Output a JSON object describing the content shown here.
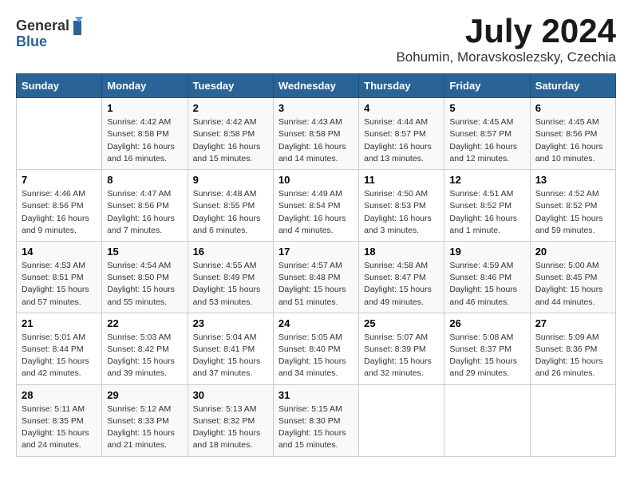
{
  "header": {
    "logo_general": "General",
    "logo_blue": "Blue",
    "month_year": "July 2024",
    "location": "Bohumin, Moravskoslezsky, Czechia"
  },
  "weekdays": [
    "Sunday",
    "Monday",
    "Tuesday",
    "Wednesday",
    "Thursday",
    "Friday",
    "Saturday"
  ],
  "weeks": [
    [
      {
        "day": "",
        "sunrise": "",
        "sunset": "",
        "daylight": ""
      },
      {
        "day": "1",
        "sunrise": "Sunrise: 4:42 AM",
        "sunset": "Sunset: 8:58 PM",
        "daylight": "Daylight: 16 hours and 16 minutes."
      },
      {
        "day": "2",
        "sunrise": "Sunrise: 4:42 AM",
        "sunset": "Sunset: 8:58 PM",
        "daylight": "Daylight: 16 hours and 15 minutes."
      },
      {
        "day": "3",
        "sunrise": "Sunrise: 4:43 AM",
        "sunset": "Sunset: 8:58 PM",
        "daylight": "Daylight: 16 hours and 14 minutes."
      },
      {
        "day": "4",
        "sunrise": "Sunrise: 4:44 AM",
        "sunset": "Sunset: 8:57 PM",
        "daylight": "Daylight: 16 hours and 13 minutes."
      },
      {
        "day": "5",
        "sunrise": "Sunrise: 4:45 AM",
        "sunset": "Sunset: 8:57 PM",
        "daylight": "Daylight: 16 hours and 12 minutes."
      },
      {
        "day": "6",
        "sunrise": "Sunrise: 4:45 AM",
        "sunset": "Sunset: 8:56 PM",
        "daylight": "Daylight: 16 hours and 10 minutes."
      }
    ],
    [
      {
        "day": "7",
        "sunrise": "Sunrise: 4:46 AM",
        "sunset": "Sunset: 8:56 PM",
        "daylight": "Daylight: 16 hours and 9 minutes."
      },
      {
        "day": "8",
        "sunrise": "Sunrise: 4:47 AM",
        "sunset": "Sunset: 8:56 PM",
        "daylight": "Daylight: 16 hours and 7 minutes."
      },
      {
        "day": "9",
        "sunrise": "Sunrise: 4:48 AM",
        "sunset": "Sunset: 8:55 PM",
        "daylight": "Daylight: 16 hours and 6 minutes."
      },
      {
        "day": "10",
        "sunrise": "Sunrise: 4:49 AM",
        "sunset": "Sunset: 8:54 PM",
        "daylight": "Daylight: 16 hours and 4 minutes."
      },
      {
        "day": "11",
        "sunrise": "Sunrise: 4:50 AM",
        "sunset": "Sunset: 8:53 PM",
        "daylight": "Daylight: 16 hours and 3 minutes."
      },
      {
        "day": "12",
        "sunrise": "Sunrise: 4:51 AM",
        "sunset": "Sunset: 8:52 PM",
        "daylight": "Daylight: 16 hours and 1 minute."
      },
      {
        "day": "13",
        "sunrise": "Sunrise: 4:52 AM",
        "sunset": "Sunset: 8:52 PM",
        "daylight": "Daylight: 15 hours and 59 minutes."
      }
    ],
    [
      {
        "day": "14",
        "sunrise": "Sunrise: 4:53 AM",
        "sunset": "Sunset: 8:51 PM",
        "daylight": "Daylight: 15 hours and 57 minutes."
      },
      {
        "day": "15",
        "sunrise": "Sunrise: 4:54 AM",
        "sunset": "Sunset: 8:50 PM",
        "daylight": "Daylight: 15 hours and 55 minutes."
      },
      {
        "day": "16",
        "sunrise": "Sunrise: 4:55 AM",
        "sunset": "Sunset: 8:49 PM",
        "daylight": "Daylight: 15 hours and 53 minutes."
      },
      {
        "day": "17",
        "sunrise": "Sunrise: 4:57 AM",
        "sunset": "Sunset: 8:48 PM",
        "daylight": "Daylight: 15 hours and 51 minutes."
      },
      {
        "day": "18",
        "sunrise": "Sunrise: 4:58 AM",
        "sunset": "Sunset: 8:47 PM",
        "daylight": "Daylight: 15 hours and 49 minutes."
      },
      {
        "day": "19",
        "sunrise": "Sunrise: 4:59 AM",
        "sunset": "Sunset: 8:46 PM",
        "daylight": "Daylight: 15 hours and 46 minutes."
      },
      {
        "day": "20",
        "sunrise": "Sunrise: 5:00 AM",
        "sunset": "Sunset: 8:45 PM",
        "daylight": "Daylight: 15 hours and 44 minutes."
      }
    ],
    [
      {
        "day": "21",
        "sunrise": "Sunrise: 5:01 AM",
        "sunset": "Sunset: 8:44 PM",
        "daylight": "Daylight: 15 hours and 42 minutes."
      },
      {
        "day": "22",
        "sunrise": "Sunrise: 5:03 AM",
        "sunset": "Sunset: 8:42 PM",
        "daylight": "Daylight: 15 hours and 39 minutes."
      },
      {
        "day": "23",
        "sunrise": "Sunrise: 5:04 AM",
        "sunset": "Sunset: 8:41 PM",
        "daylight": "Daylight: 15 hours and 37 minutes."
      },
      {
        "day": "24",
        "sunrise": "Sunrise: 5:05 AM",
        "sunset": "Sunset: 8:40 PM",
        "daylight": "Daylight: 15 hours and 34 minutes."
      },
      {
        "day": "25",
        "sunrise": "Sunrise: 5:07 AM",
        "sunset": "Sunset: 8:39 PM",
        "daylight": "Daylight: 15 hours and 32 minutes."
      },
      {
        "day": "26",
        "sunrise": "Sunrise: 5:08 AM",
        "sunset": "Sunset: 8:37 PM",
        "daylight": "Daylight: 15 hours and 29 minutes."
      },
      {
        "day": "27",
        "sunrise": "Sunrise: 5:09 AM",
        "sunset": "Sunset: 8:36 PM",
        "daylight": "Daylight: 15 hours and 26 minutes."
      }
    ],
    [
      {
        "day": "28",
        "sunrise": "Sunrise: 5:11 AM",
        "sunset": "Sunset: 8:35 PM",
        "daylight": "Daylight: 15 hours and 24 minutes."
      },
      {
        "day": "29",
        "sunrise": "Sunrise: 5:12 AM",
        "sunset": "Sunset: 8:33 PM",
        "daylight": "Daylight: 15 hours and 21 minutes."
      },
      {
        "day": "30",
        "sunrise": "Sunrise: 5:13 AM",
        "sunset": "Sunset: 8:32 PM",
        "daylight": "Daylight: 15 hours and 18 minutes."
      },
      {
        "day": "31",
        "sunrise": "Sunrise: 5:15 AM",
        "sunset": "Sunset: 8:30 PM",
        "daylight": "Daylight: 15 hours and 15 minutes."
      },
      {
        "day": "",
        "sunrise": "",
        "sunset": "",
        "daylight": ""
      },
      {
        "day": "",
        "sunrise": "",
        "sunset": "",
        "daylight": ""
      },
      {
        "day": "",
        "sunrise": "",
        "sunset": "",
        "daylight": ""
      }
    ]
  ]
}
